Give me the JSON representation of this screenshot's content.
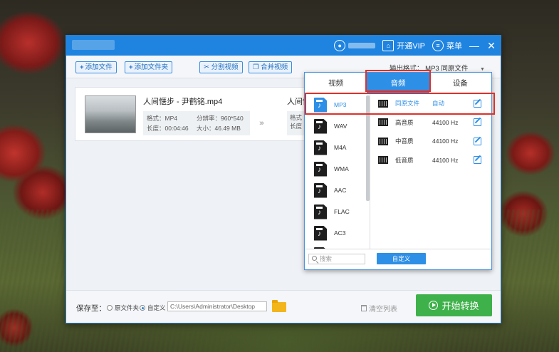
{
  "window": {
    "user_icon": "user-icon",
    "vip_label": "开通VIP",
    "menu_label": "菜单",
    "minimize": "—",
    "close": "✕"
  },
  "toolbar": {
    "add_file": "添加文件",
    "add_folder": "添加文件夹",
    "split_video": "分割视频",
    "merge_video": "合并视频"
  },
  "file": {
    "name": "人间惬步 - 尹鹤铭.mp4",
    "format_label": "格式：MP4",
    "resolution_label": "分辨率：960*540",
    "duration_label": "长度：00:04:46",
    "size_label": "大小：46.49 MB",
    "output_name": "人间惬",
    "output_format": "格式",
    "output_duration": "长度"
  },
  "output": {
    "label": "输出格式：",
    "value": "MP3  同原文件"
  },
  "panel": {
    "tabs": [
      "视频",
      "音频",
      "设备"
    ],
    "active_tab": 1,
    "formats": [
      "MP3",
      "WAV",
      "M4A",
      "WMA",
      "AAC",
      "FLAC",
      "AC3"
    ],
    "selected_format": 0,
    "qualities": [
      {
        "name": "同原文件",
        "rate": "自动"
      },
      {
        "name": "高音质",
        "rate": "44100 Hz"
      },
      {
        "name": "中音质",
        "rate": "44100 Hz"
      },
      {
        "name": "低音质",
        "rate": "44100 Hz"
      }
    ],
    "search_placeholder": "搜索",
    "custom_button": "自定义"
  },
  "bottom": {
    "save_to": "保存至：",
    "radio_source": "原文件夹",
    "radio_custom": "自定义",
    "path": "C:\\Users\\Administrator\\Desktop",
    "clear_list": "清空列表",
    "start": "开始转换"
  },
  "colors": {
    "accent": "#2e8fe6",
    "titlebar": "#1f84e0",
    "start": "#3fb14a",
    "highlight": "#e0302a"
  }
}
